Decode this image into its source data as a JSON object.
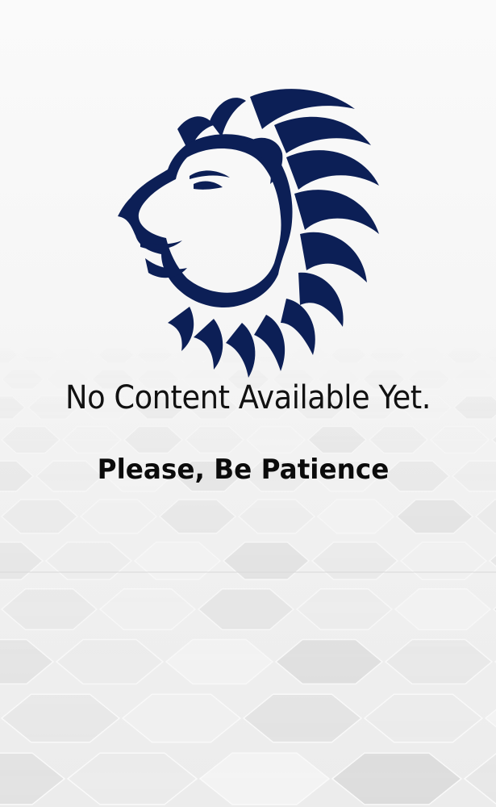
{
  "screen": {
    "headline": "No Content Available Yet.",
    "subline": "Please, Be Patience"
  },
  "logo": {
    "icon": "lion-head-icon",
    "color": "#0c1f56"
  },
  "colors": {
    "background": "#f7f7f7",
    "text": "#111111"
  }
}
